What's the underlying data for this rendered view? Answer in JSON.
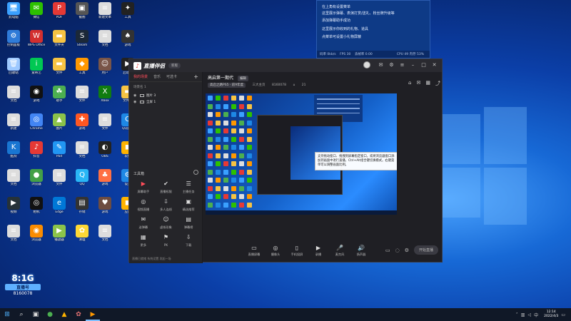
{
  "notification": {
    "lines": [
      "在上角有设置菜单",
      "这里展示弹幕、表演打赏/送礼、粉丝牌升级等",
      "添加弹幕助手成功",
      "这里展示你收到的礼物、道具",
      "点菜单可设置小礼物屏蔽"
    ],
    "status_left": [
      "码率 0kb/s",
      "FPS 30",
      "丢帧率 0.00"
    ],
    "status_right": "CPU 49 内存 53%"
  },
  "desktop": {
    "icons": [
      {
        "label": "此电脑",
        "color": "#3aa0ff",
        "glyph": "🖥"
      },
      {
        "label": "微信",
        "color": "#2dc100",
        "glyph": "✉"
      },
      {
        "label": "PDF",
        "color": "#e53935",
        "glyph": "P"
      },
      {
        "label": "截图",
        "color": "#555",
        "glyph": "▣"
      },
      {
        "label": "新建文本",
        "color": "#ddd",
        "glyph": "≡"
      },
      {
        "label": "工具",
        "color": "#222",
        "glyph": "✦"
      },
      {
        "label": "控制面板",
        "color": "#2f7bd8",
        "glyph": "⚙"
      },
      {
        "label": "WPS Office",
        "color": "#d32f2f",
        "glyph": "W"
      },
      {
        "label": "文件夹",
        "color": "#f6c343",
        "glyph": "▬"
      },
      {
        "label": "Steam",
        "color": "#1b2838",
        "glyph": "S"
      },
      {
        "label": "文档",
        "color": "#ddd",
        "glyph": "≡"
      },
      {
        "label": "游戏",
        "color": "#333",
        "glyph": "♠"
      },
      {
        "label": "回收站",
        "color": "#9ec9ff",
        "glyph": "🗑"
      },
      {
        "label": "爱奇艺",
        "color": "#00c853",
        "glyph": "i"
      },
      {
        "label": "文件",
        "color": "#f6c343",
        "glyph": "▬"
      },
      {
        "label": "工具",
        "color": "#ff9800",
        "glyph": "◆"
      },
      {
        "label": "用户",
        "color": "#795548",
        "glyph": "☺"
      },
      {
        "label": "启动器",
        "color": "#222",
        "glyph": "▶"
      },
      {
        "label": "文档",
        "color": "#ddd",
        "glyph": "≡"
      },
      {
        "label": "游戏",
        "color": "#111",
        "glyph": "◉"
      },
      {
        "label": "助手",
        "color": "#4caf50",
        "glyph": "☘"
      },
      {
        "label": "文件",
        "color": "#ddd",
        "glyph": "≡"
      },
      {
        "label": "Xbox",
        "color": "#107c10",
        "glyph": "X"
      },
      {
        "label": "文件夹",
        "color": "#f6c343",
        "glyph": "▬"
      },
      {
        "label": "新建",
        "color": "#ddd",
        "glyph": "≡"
      },
      {
        "label": "Chrome",
        "color": "#4285f4",
        "glyph": "◎"
      },
      {
        "label": "图片",
        "color": "#8bc34a",
        "glyph": "▲"
      },
      {
        "label": "游戏",
        "color": "#ff5722",
        "glyph": "✚"
      },
      {
        "label": "文件",
        "color": "#ddd",
        "glyph": "≡"
      },
      {
        "label": "QQ游戏",
        "color": "#1e88e5",
        "glyph": "Q"
      },
      {
        "label": "酷狗",
        "color": "#1976d2",
        "glyph": "K"
      },
      {
        "label": "抖音",
        "color": "#e53935",
        "glyph": "♪"
      },
      {
        "label": "Pad",
        "color": "#2196f3",
        "glyph": "✎"
      },
      {
        "label": "文档",
        "color": "#ddd",
        "glyph": "≡"
      },
      {
        "label": "OBS",
        "color": "#222",
        "glyph": "◐"
      },
      {
        "label": "软件",
        "color": "#ffb300",
        "glyph": "◼"
      },
      {
        "label": "文档",
        "color": "#ddd",
        "glyph": "≡"
      },
      {
        "label": "浏览器",
        "color": "#43a047",
        "glyph": "●"
      },
      {
        "label": "文件",
        "color": "#ddd",
        "glyph": "≡"
      },
      {
        "label": "QQ",
        "color": "#29b6f6",
        "glyph": "Q"
      },
      {
        "label": "游戏",
        "color": "#ff7043",
        "glyph": "♣"
      },
      {
        "label": "设置",
        "color": "#1e88e5",
        "glyph": "⚙"
      },
      {
        "label": "视频",
        "color": "#263238",
        "glyph": "▶"
      },
      {
        "label": "相机",
        "color": "#111",
        "glyph": "◎"
      },
      {
        "label": "Edge",
        "color": "#0078d7",
        "glyph": "e"
      },
      {
        "label": "存储",
        "color": "#333",
        "glyph": "▤"
      },
      {
        "label": "游戏",
        "color": "#6d4c41",
        "glyph": "♥"
      },
      {
        "label": "应用",
        "color": "#ffb300",
        "glyph": "◼"
      },
      {
        "label": "文档",
        "color": "#ddd",
        "glyph": "≡"
      },
      {
        "label": "浏览器",
        "color": "#fb8c00",
        "glyph": "◉"
      },
      {
        "label": "播放器",
        "color": "#8bc34a",
        "glyph": "▶"
      },
      {
        "label": "清理",
        "color": "#fdd835",
        "glyph": "✿"
      },
      {
        "label": "文档",
        "color": "#ddd",
        "glyph": "≡"
      }
    ]
  },
  "app": {
    "logo_text": "直播伴侣",
    "version_badge": "新版",
    "left_tabs": [
      "我的场景",
      "音乐",
      "可选卡"
    ],
    "scene_header": "场景名 1",
    "scenes": [
      {
        "label": "图片 3"
      },
      {
        "label": "全屏 1"
      }
    ],
    "toolbox_title": "工具箱",
    "tools": [
      {
        "label": "屏幕助手",
        "glyph": "▶",
        "red": true
      },
      {
        "label": "直播权限",
        "glyph": "✔",
        "red": false
      },
      {
        "label": "主播任务",
        "glyph": "☰",
        "red": false
      },
      {
        "label": "视频直播",
        "glyph": "◎",
        "red": false
      },
      {
        "label": "多人连线",
        "glyph": "⇩",
        "red": false
      },
      {
        "label": "精选推荐",
        "glyph": "▣",
        "red": false
      },
      {
        "label": "送弹幕",
        "glyph": "✉",
        "red": false
      },
      {
        "label": "虚拟形象",
        "glyph": "☺",
        "red": false
      },
      {
        "label": "弹幕榜",
        "glyph": "▤",
        "red": false
      },
      {
        "label": "更多",
        "glyph": "▦",
        "red": false
      },
      {
        "label": "PK",
        "glyph": "⚑",
        "red": false
      },
      {
        "label": "下载",
        "glyph": "⇩",
        "red": false
      }
    ],
    "left_footer": "直播已就绪 系统设置 发起一场",
    "room_title": "高启第一期代",
    "edit_label": "编辑",
    "room_sub": [
      "高启之路PS5 · 前9年度",
      "三大主页",
      "8160078"
    ],
    "viewer_count": "21",
    "tooltip_text": "支持拖动窗口、拖拽到屏幕指定窗口，或将浏览器窗口添加到画面中进行直播，Ctrl+Alt组合键切换模式。右键菜单可以调整画面比例。",
    "bottom_buttons": [
      {
        "label": "直播屏幕",
        "glyph": "▭"
      },
      {
        "label": "摄像头",
        "glyph": "◎"
      },
      {
        "label": "手机投屏",
        "glyph": "▯"
      },
      {
        "label": "录播",
        "glyph": "▶"
      },
      {
        "label": "麦克风",
        "glyph": "🎤"
      },
      {
        "label": "扬声器",
        "glyph": "🔊"
      }
    ],
    "go_live": "开始直播"
  },
  "overlay": {
    "top": "8:1G",
    "mid": "直播号",
    "id": "8160078"
  },
  "taskbar": {
    "apps": [
      "⊞",
      "⌕",
      "▣",
      "●",
      "▲",
      "✿",
      "▶"
    ],
    "time": "12:14",
    "date": "2022/4/3"
  }
}
